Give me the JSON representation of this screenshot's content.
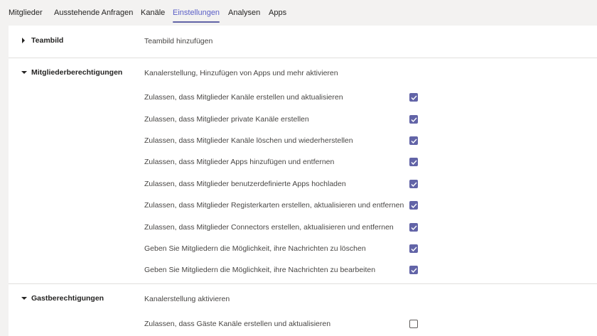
{
  "tabs": [
    {
      "label": "Mitglieder"
    },
    {
      "label": "Ausstehende Anfragen"
    },
    {
      "label": "Kanäle"
    },
    {
      "label": "Einstellungen",
      "active": true
    },
    {
      "label": "Analysen"
    },
    {
      "label": "Apps"
    }
  ],
  "accent_color": "#6264a7",
  "sections": {
    "teambild": {
      "title": "Teambild",
      "description": "Teambild hinzufügen",
      "expanded": false
    },
    "mitglieder": {
      "title": "Mitgliederberechtigungen",
      "description": "Kanalerstellung, Hinzufügen von Apps und mehr aktivieren",
      "expanded": true,
      "options": [
        {
          "label": "Zulassen, dass Mitglieder Kanäle erstellen und aktualisieren",
          "checked": true
        },
        {
          "label": "Zulassen, dass Mitglieder private Kanäle erstellen",
          "checked": true
        },
        {
          "label": "Zulassen, dass Mitglieder Kanäle löschen und wiederherstellen",
          "checked": true
        },
        {
          "label": "Zulassen, dass Mitglieder Apps hinzufügen und entfernen",
          "checked": true
        },
        {
          "label": "Zulassen, dass Mitglieder benutzerdefinierte Apps hochladen",
          "checked": true
        },
        {
          "label": "Zulassen, dass Mitglieder Registerkarten erstellen, aktualisieren und entfernen",
          "checked": true
        },
        {
          "label": "Zulassen, dass Mitglieder Connectors erstellen, aktualisieren und entfernen",
          "checked": true
        },
        {
          "label": "Geben Sie Mitgliedern die Möglichkeit, ihre Nachrichten zu löschen",
          "checked": true
        },
        {
          "label": "Geben Sie Mitgliedern die Möglichkeit, ihre Nachrichten zu bearbeiten",
          "checked": true
        }
      ]
    },
    "gast": {
      "title": "Gastberechtigungen",
      "description": "Kanalerstellung aktivieren",
      "expanded": true,
      "options": [
        {
          "label": "Zulassen, dass Gäste Kanäle erstellen und aktualisieren",
          "checked": false
        }
      ]
    }
  }
}
